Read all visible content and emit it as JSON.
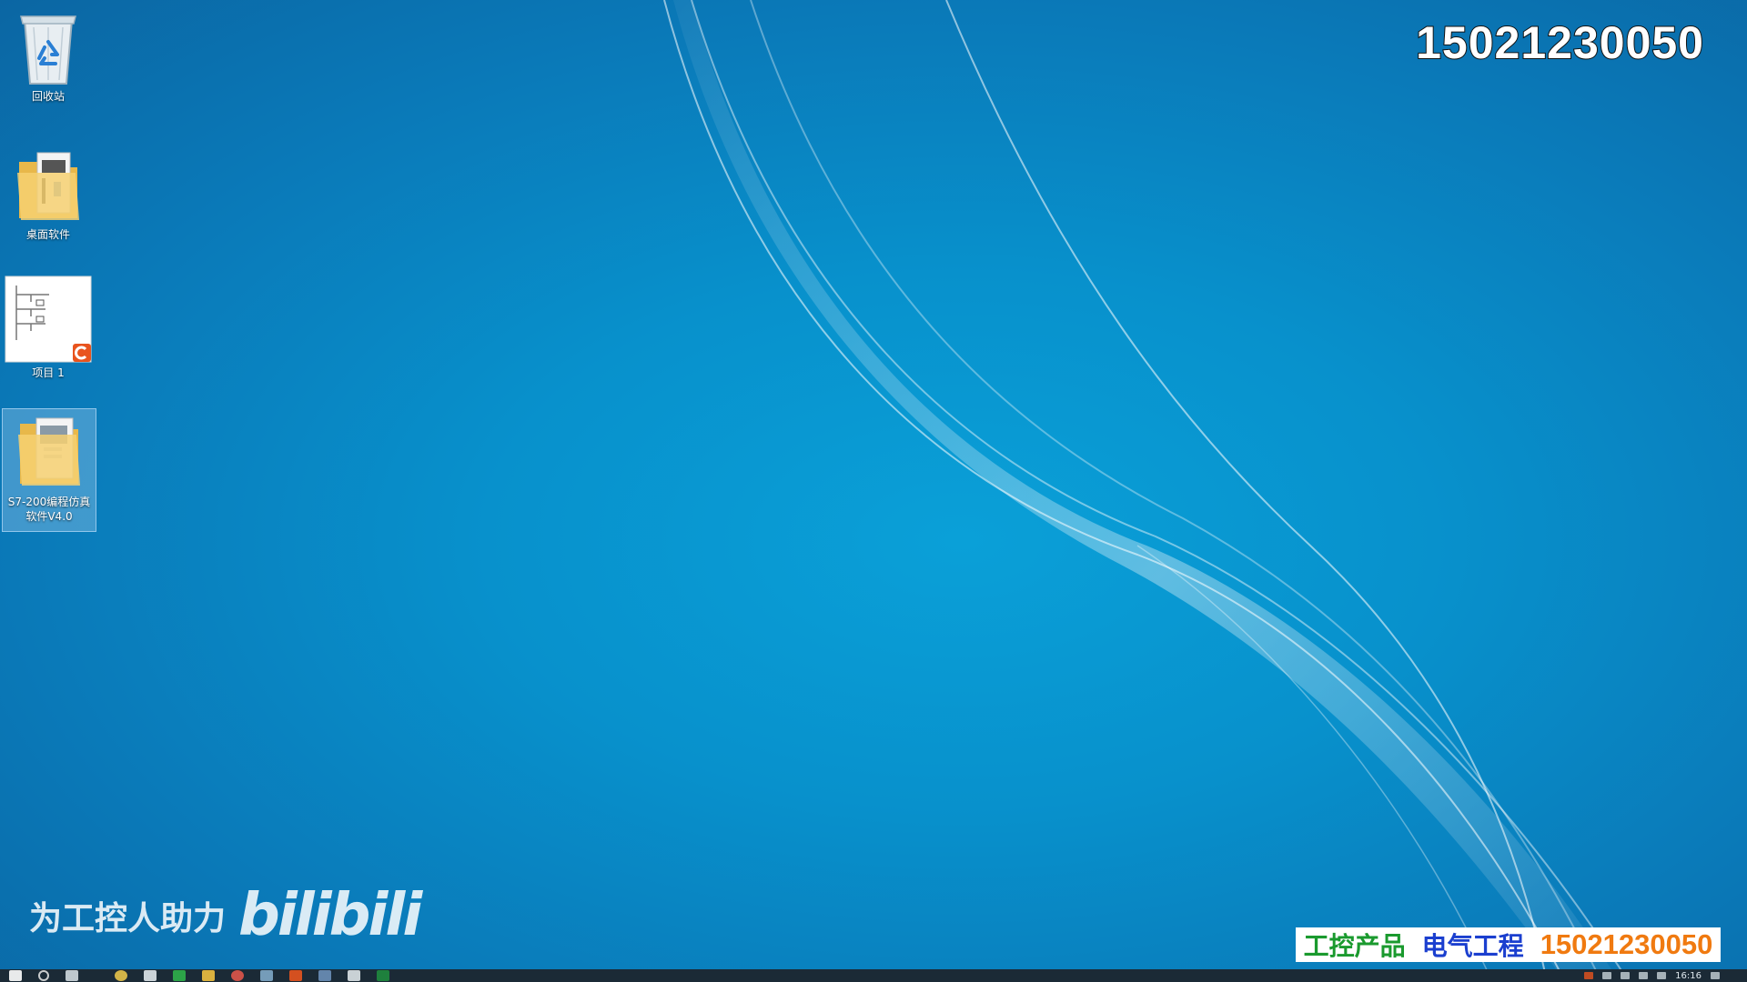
{
  "desktop": {
    "icons": [
      {
        "label": "回收站",
        "icon": "recycle-bin-icon"
      },
      {
        "label": "桌面软件",
        "icon": "folder-icon"
      },
      {
        "label": "项目 1",
        "icon": "project-file-icon"
      },
      {
        "label": "S7-200编程仿真软件V4.0",
        "icon": "folder-icon"
      }
    ]
  },
  "overlay": {
    "phone_top": "15021230050",
    "slogan": "为工控人助力",
    "logo": "bilibili",
    "promo_part1": "工控产品",
    "promo_part2": "电气工程",
    "promo_part3": "15021230050"
  },
  "taskbar": {
    "clock": "16:16",
    "pinned": [
      "windows-start-icon",
      "search-icon",
      "task-view-icon",
      "chrome-icon",
      "explorer-icon",
      "folder-icon",
      "browser-icon",
      "tia-portal-icon",
      "app-icon",
      "window-icon",
      "app-icon",
      "excel-icon"
    ]
  },
  "colors": {
    "desktop_bg": "#0891cc",
    "promo_green": "#1a9a2e",
    "promo_blue": "#1b3fcf",
    "promo_orange": "#f07a10",
    "taskbar_bg": "#1b2a36"
  }
}
